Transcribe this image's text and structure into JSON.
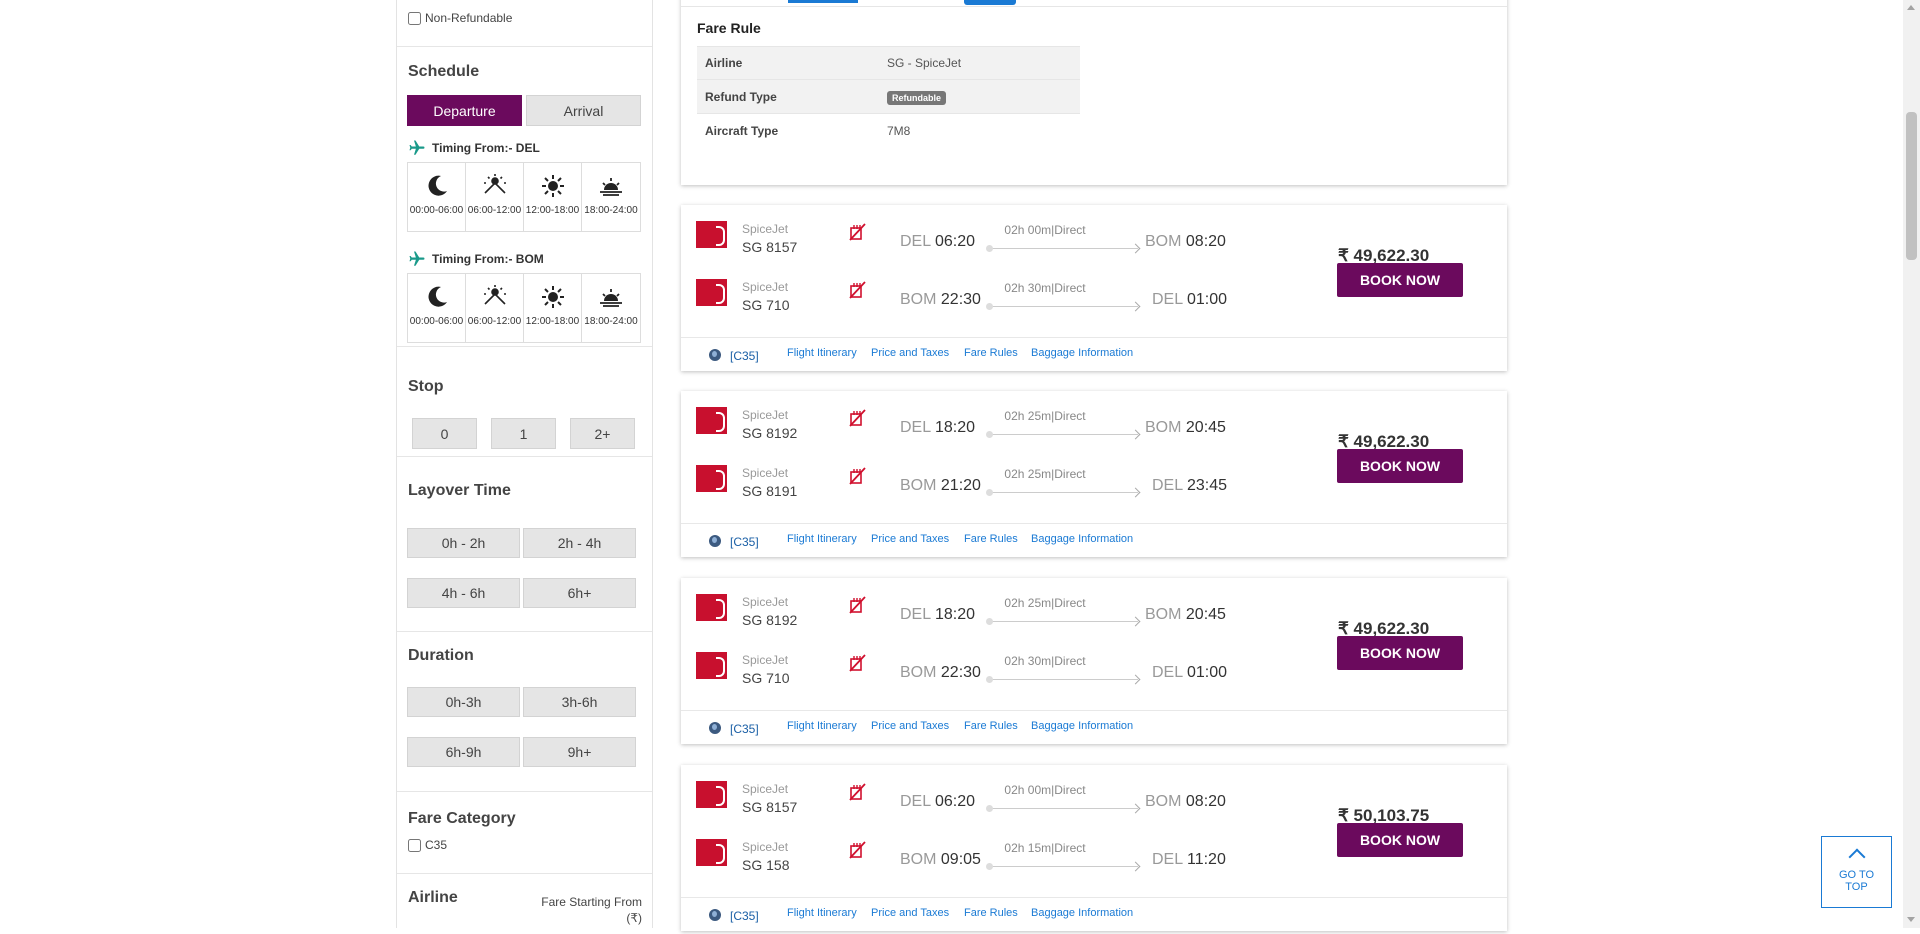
{
  "filters": {
    "non_refundable_label": "Non-Refundable",
    "schedule": {
      "title": "Schedule",
      "departure_label": "Departure",
      "arrival_label": "Arrival",
      "timing_from_del": "Timing From:- DEL",
      "timing_from_bom": "Timing From:- BOM",
      "slots": [
        "00:00-06:00",
        "06:00-12:00",
        "12:00-18:00",
        "18:00-24:00"
      ]
    },
    "stop": {
      "title": "Stop",
      "options": [
        "0",
        "1",
        "2+"
      ]
    },
    "layover": {
      "title": "Layover Time",
      "options": [
        "0h - 2h",
        "2h - 4h",
        "4h - 6h",
        "6h+"
      ]
    },
    "duration": {
      "title": "Duration",
      "options": [
        "0h-3h",
        "3h-6h",
        "6h-9h",
        "9h+"
      ]
    },
    "fare_category": {
      "title": "Fare Category",
      "option": "C35"
    },
    "airline": {
      "title": "Airline",
      "fare_starting_from": "Fare Starting From",
      "currency": "(₹)"
    }
  },
  "fare_rule": {
    "title": "Fare Rule",
    "rows": [
      {
        "label": "Airline",
        "value": "SG - SpiceJet"
      },
      {
        "label": "Refund Type",
        "value": "Refundable"
      },
      {
        "label": "Aircraft Type",
        "value": "7M8"
      }
    ]
  },
  "results": [
    {
      "legs": [
        {
          "airline": "SpiceJet",
          "flight": "SG  8157",
          "from": "DEL",
          "dep": "06:20",
          "duration": "02h 00m|Direct",
          "to": "BOM",
          "arr": "08:20"
        },
        {
          "airline": "SpiceJet",
          "flight": "SG  710",
          "from": "BOM",
          "dep": "22:30",
          "duration": "02h 30m|Direct",
          "to": "DEL",
          "arr": "01:00"
        }
      ],
      "price": "₹ 49,622.30"
    },
    {
      "legs": [
        {
          "airline": "SpiceJet",
          "flight": "SG  8192",
          "from": "DEL",
          "dep": "18:20",
          "duration": "02h 25m|Direct",
          "to": "BOM",
          "arr": "20:45"
        },
        {
          "airline": "SpiceJet",
          "flight": "SG  8191",
          "from": "BOM",
          "dep": "21:20",
          "duration": "02h 25m|Direct",
          "to": "DEL",
          "arr": "23:45"
        }
      ],
      "price": "₹ 49,622.30"
    },
    {
      "legs": [
        {
          "airline": "SpiceJet",
          "flight": "SG  8192",
          "from": "DEL",
          "dep": "18:20",
          "duration": "02h 25m|Direct",
          "to": "BOM",
          "arr": "20:45"
        },
        {
          "airline": "SpiceJet",
          "flight": "SG  710",
          "from": "BOM",
          "dep": "22:30",
          "duration": "02h 30m|Direct",
          "to": "DEL",
          "arr": "01:00"
        }
      ],
      "price": "₹ 49,622.30"
    },
    {
      "legs": [
        {
          "airline": "SpiceJet",
          "flight": "SG  8157",
          "from": "DEL",
          "dep": "06:20",
          "duration": "02h 00m|Direct",
          "to": "BOM",
          "arr": "08:20"
        },
        {
          "airline": "SpiceJet",
          "flight": "SG  158",
          "from": "BOM",
          "dep": "09:05",
          "duration": "02h 15m|Direct",
          "to": "DEL",
          "arr": "11:20"
        }
      ],
      "price": "₹ 50,103.75"
    }
  ],
  "card_footer": {
    "fare_class": "[C35]",
    "links": [
      "Flight Itinerary",
      "Price and Taxes",
      "Fare Rules",
      "Baggage Information"
    ]
  },
  "book_label": "BOOK NOW",
  "go_to_top": {
    "line1": "GO TO",
    "line2": "TOP"
  },
  "colors": {
    "brand_purple": "#6b0a5d",
    "link_blue": "#1a7ad4",
    "spicejet_red": "#c8102e",
    "plane_teal": "#1a9a8a"
  },
  "icons": [
    "plane-icon",
    "moon-icon",
    "sunrise-icon",
    "sun-icon",
    "sunset-icon",
    "no-meal-icon",
    "globe-icon",
    "chevron-up-icon"
  ]
}
